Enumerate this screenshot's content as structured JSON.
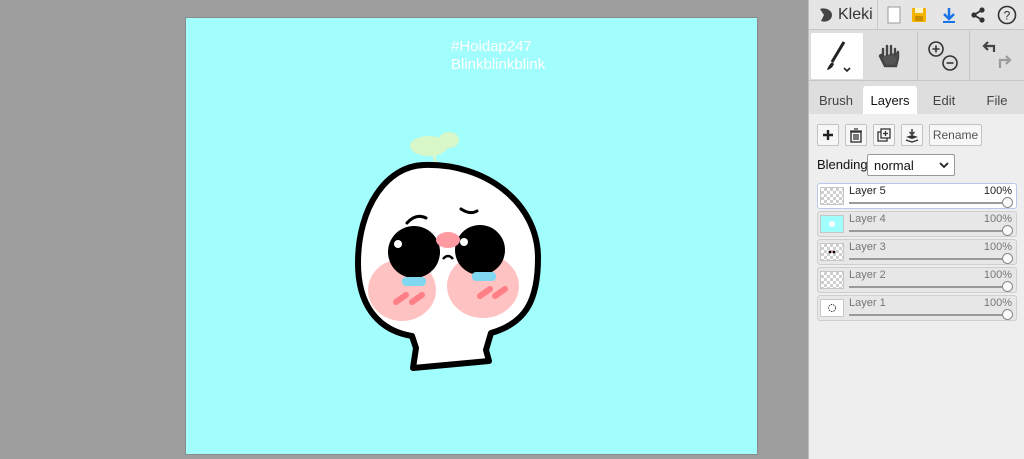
{
  "canvas": {
    "background_color": "#a2fdfd",
    "overlay_text": [
      "#Hoidap247",
      "Blinkblinkblink"
    ]
  },
  "app": {
    "name": "Kleki",
    "top_icons": [
      "new-image-icon",
      "save-icon",
      "download-icon",
      "share-icon",
      "help-icon"
    ]
  },
  "tools": [
    "brush-tool",
    "hand-tool",
    "zoom-in-out",
    "undo-redo"
  ],
  "tabs": [
    {
      "label": "Brush",
      "active": false
    },
    {
      "label": "Layers",
      "active": true
    },
    {
      "label": "Edit",
      "active": false
    },
    {
      "label": "File",
      "active": false
    }
  ],
  "layers_panel": {
    "rename_label": "Rename",
    "blending_label": "Blending",
    "blending_value": "normal",
    "layers": [
      {
        "name": "Layer 5",
        "opacity": "100%",
        "active": true
      },
      {
        "name": "Layer 4",
        "opacity": "100%",
        "active": false
      },
      {
        "name": "Layer 3",
        "opacity": "100%",
        "active": false
      },
      {
        "name": "Layer 2",
        "opacity": "100%",
        "active": false
      },
      {
        "name": "Layer 1",
        "opacity": "100%",
        "active": false
      }
    ]
  },
  "colors": {
    "accent_download": "#1a73e8",
    "save_icon": "#f4b400",
    "cheek": "#ffc2c2",
    "tears": "#7fd8f0",
    "sprout": "#d8f7c8"
  }
}
